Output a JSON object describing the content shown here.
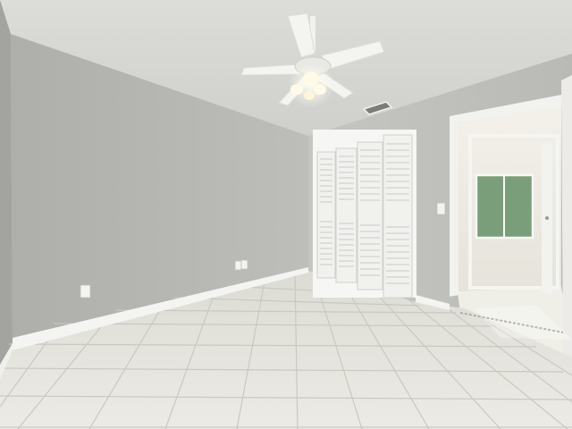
{
  "scene": {
    "subject": "empty-bedroom-interior",
    "elements": [
      "ceiling-fan",
      "air-vent",
      "bifold-closet-doors",
      "light-switch",
      "wall-outlets",
      "tile-floor",
      "open-doorway",
      "hallway-window"
    ],
    "colors": {
      "wall_left": "#b6b7b3",
      "wall_back": "#c3c4c0",
      "ceiling": "#d6d6d3",
      "floor": "#e6e5df",
      "grout": "#c9c8c1",
      "trim": "#f4f4f2",
      "closet": "#f1f1ee",
      "window_glass": "#7a9e7a",
      "light": "#fffbe8"
    }
  }
}
